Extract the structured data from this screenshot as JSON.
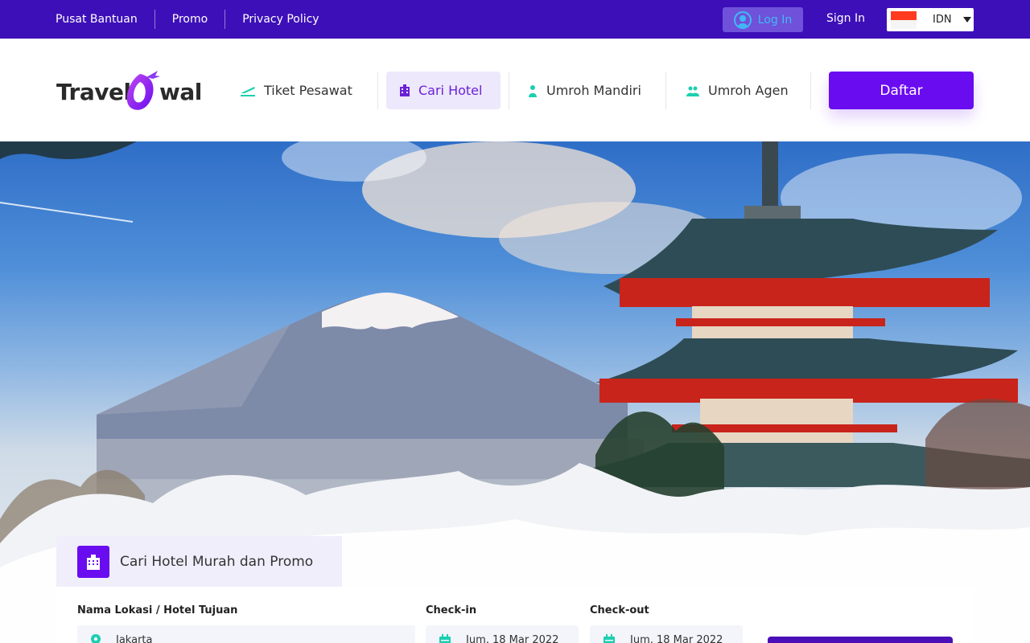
{
  "topbar": {
    "links": [
      "Pusat Bantuan",
      "Promo",
      "Privacy Policy"
    ],
    "login_label": "Log In",
    "signin_label": "Sign In",
    "language": "IDN"
  },
  "header": {
    "logo_left": "Travel",
    "logo_right": "wal",
    "nav": [
      {
        "label": "Tiket Pesawat",
        "icon": "plane-takeoff-icon",
        "active": false
      },
      {
        "label": "Cari Hotel",
        "icon": "hotel-icon",
        "active": true
      },
      {
        "label": "Umroh Mandiri",
        "icon": "person-icon",
        "active": false
      },
      {
        "label": "Umroh Agen",
        "icon": "group-icon",
        "active": false
      }
    ],
    "register_label": "Daftar"
  },
  "search": {
    "tab_title": "Cari Hotel Murah dan Promo",
    "location_label": "Nama Lokasi / Hotel Tujuan",
    "location_value": "Jakarta",
    "checkin_label": "Check-in",
    "checkin_value": "Jum, 18 Mar 2022",
    "checkout_label": "Check-out",
    "checkout_value": "Jum, 18 Mar 2022"
  },
  "colors": {
    "primary": "#6a0cf0",
    "topbar": "#3d0fb8",
    "accent": "#1ccfb0"
  }
}
